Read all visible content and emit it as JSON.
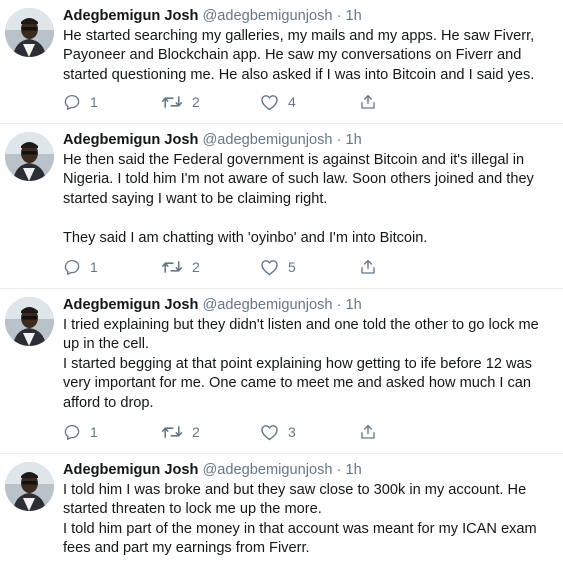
{
  "tweets": [
    {
      "name": "Adegbemigun Josh",
      "handle": "@adegbemigunjosh",
      "time": "1h",
      "text": "He started searching my galleries, my mails and my apps. He saw Fiverr, Payoneer and Blockchain app. He saw my conversations on Fiverr and started questioning me. He also asked if I was into Bitcoin and I said yes.",
      "replies": "1",
      "retweets": "2",
      "likes": "4"
    },
    {
      "name": "Adegbemigun Josh",
      "handle": "@adegbemigunjosh",
      "time": "1h",
      "text": "He then said the Federal government is against Bitcoin and it's illegal in Nigeria. I told him I'm not aware of such law. Soon others joined and they started saying I want to be claiming right.\n\nThey said I am chatting with 'oyinbo' and I'm into Bitcoin.",
      "replies": "1",
      "retweets": "2",
      "likes": "5"
    },
    {
      "name": "Adegbemigun Josh",
      "handle": "@adegbemigunjosh",
      "time": "1h",
      "text": "I tried explaining but they didn't listen and one told the other to go lock me up in the cell.\nI started begging at that point explaining how getting to ife before 12 was very important for me. One came to meet me and asked how much I can afford to drop.",
      "replies": "1",
      "retweets": "2",
      "likes": "3"
    },
    {
      "name": "Adegbemigun Josh",
      "handle": "@adegbemigunjosh",
      "time": "1h",
      "text": "I told him I was broke and but they saw close to 300k in my account. He started threaten to lock me up the more.\nI told him part of the money in that account was meant for my ICAN exam fees and part my earnings from Fiverr.",
      "replies": "",
      "retweets": "",
      "likes": ""
    }
  ],
  "icons": {
    "reply": "reply-icon",
    "retweet": "retweet-icon",
    "like": "heart-icon",
    "share": "share-icon"
  },
  "colors": {
    "text": "#14171a",
    "muted": "#657786",
    "divider": "#e6ecf0"
  }
}
